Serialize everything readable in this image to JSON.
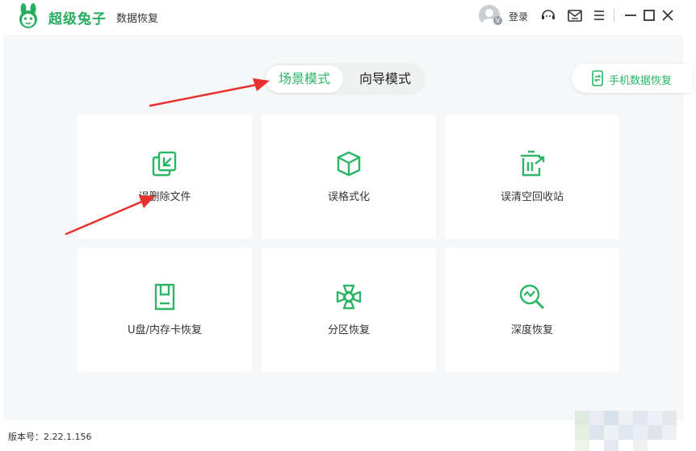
{
  "app": {
    "brand": "超级兔子",
    "product": "数据恢复"
  },
  "header": {
    "login_label": "登录",
    "avatar_badge": "V",
    "icons": [
      "service-icon",
      "message-icon",
      "menu-icon",
      "minimize-icon",
      "maximize-icon",
      "close-icon"
    ]
  },
  "modes": {
    "scene_label": "场景模式",
    "guide_label": "向导模式",
    "active": "scene"
  },
  "phone_recovery": {
    "label": "手机数据恢复"
  },
  "scenarios": [
    {
      "label": "误删除文件",
      "icon": "deleted-file-icon"
    },
    {
      "label": "误格式化",
      "icon": "format-cube-icon"
    },
    {
      "label": "误清空回收站",
      "icon": "recycle-bin-icon"
    },
    {
      "label": "U盘/内存卡恢复",
      "icon": "sd-card-icon"
    },
    {
      "label": "分区恢复",
      "icon": "partition-icon"
    },
    {
      "label": "深度恢复",
      "icon": "deep-scan-icon"
    }
  ],
  "footer": {
    "version": "版本号：2.22.1.156"
  },
  "colors": {
    "accent": "#2cb565",
    "annotation_arrow": "#e8312f",
    "background": "#f6f7f8"
  }
}
